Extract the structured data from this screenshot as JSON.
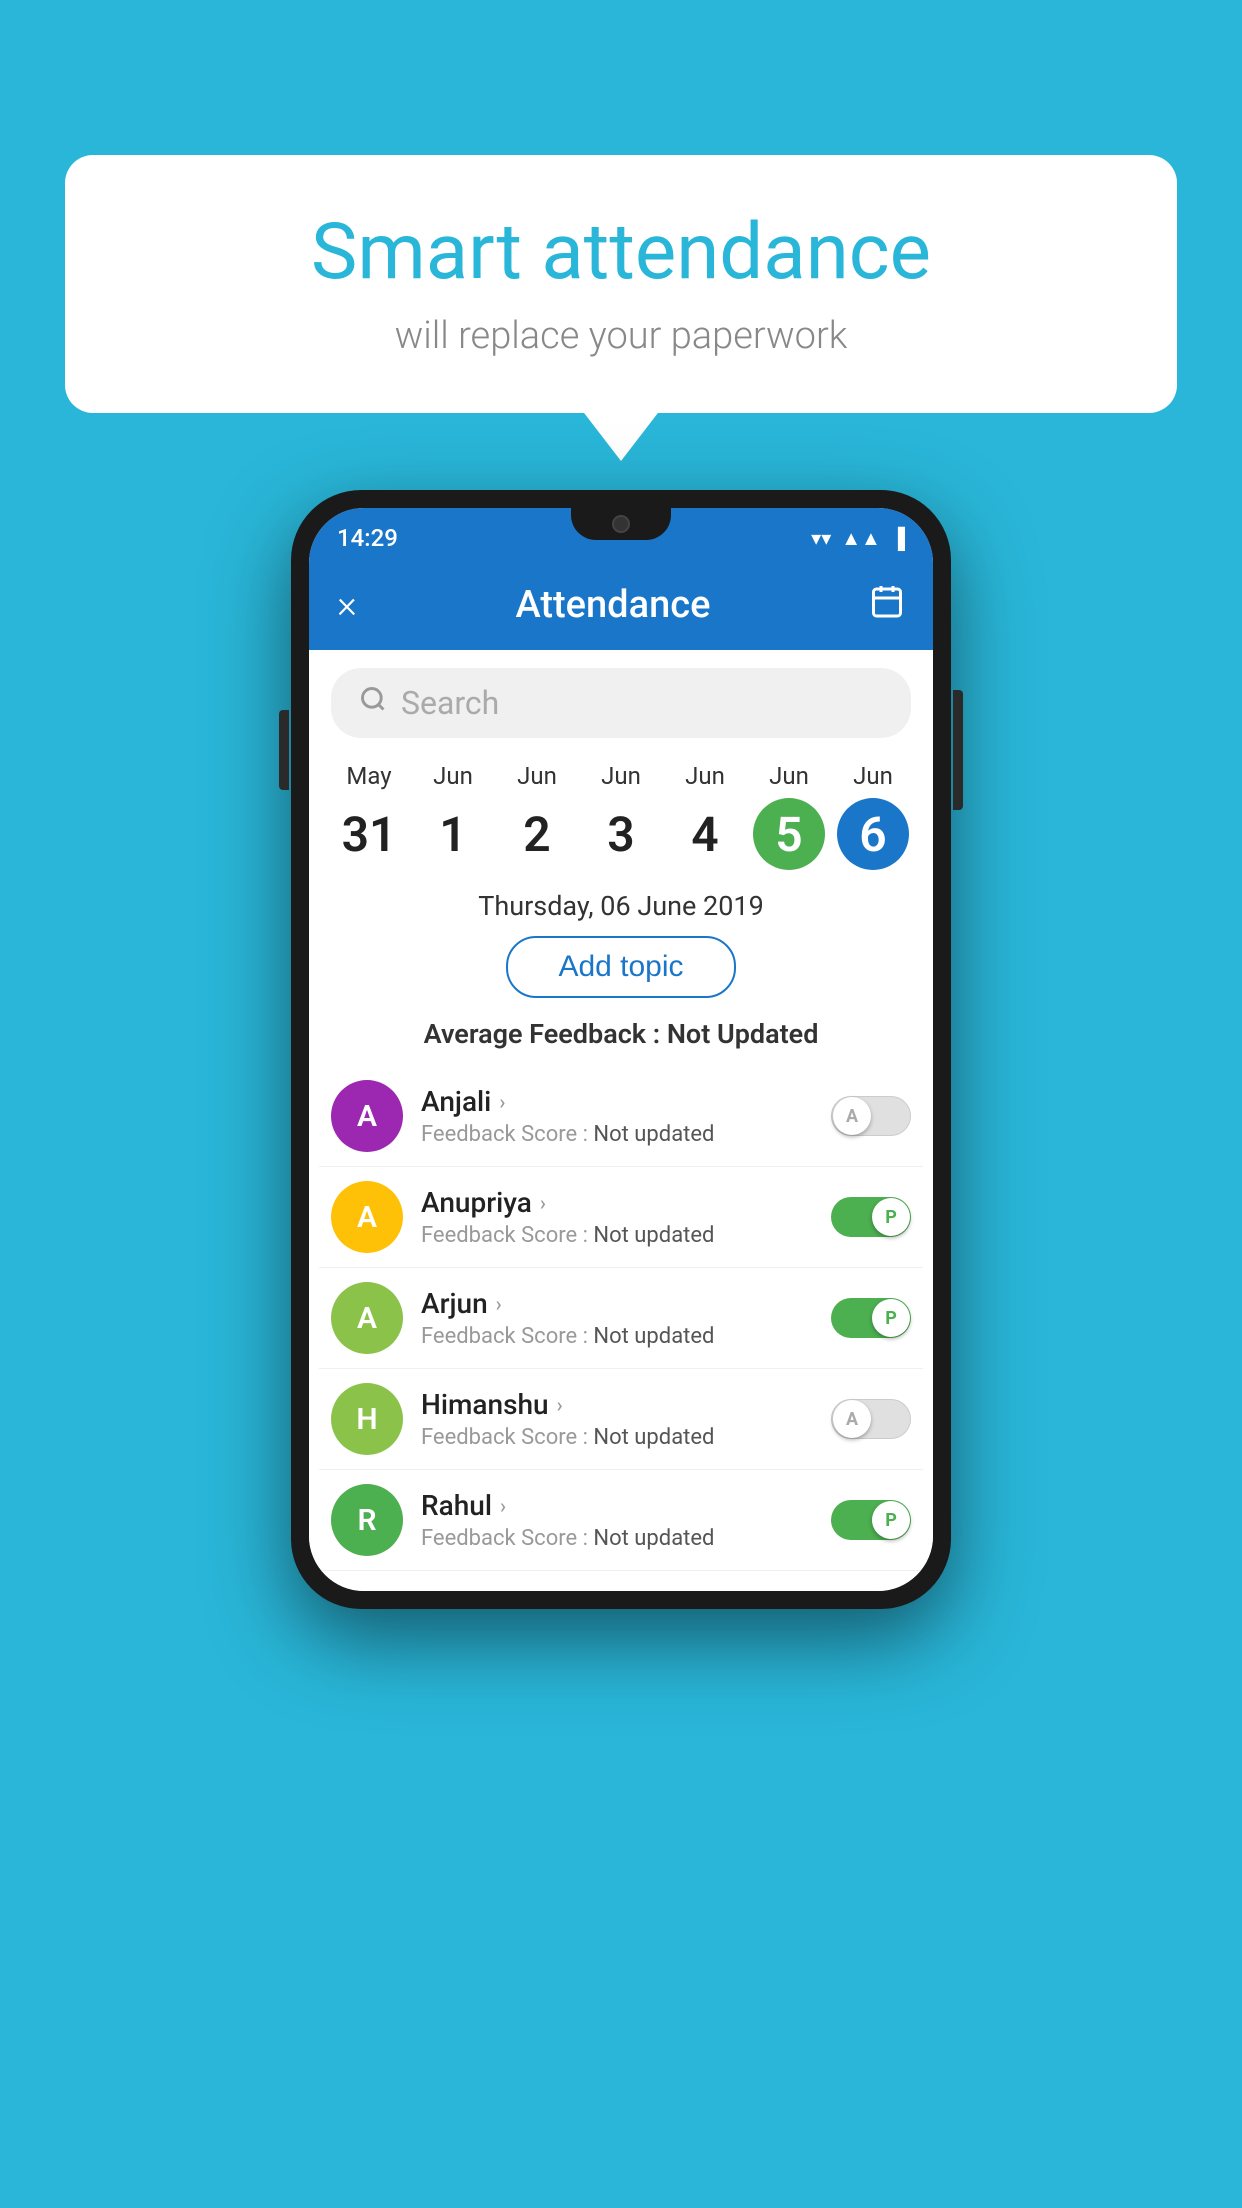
{
  "background_color": "#29b6d8",
  "speech_bubble": {
    "title": "Smart attendance",
    "subtitle": "will replace your paperwork"
  },
  "status_bar": {
    "time": "14:29",
    "icons": [
      "wifi",
      "signal",
      "battery"
    ]
  },
  "app_header": {
    "title": "Attendance",
    "close_label": "×",
    "calendar_icon": "📅"
  },
  "search": {
    "placeholder": "Search"
  },
  "dates": [
    {
      "month": "May",
      "day": "31",
      "state": "normal"
    },
    {
      "month": "Jun",
      "day": "1",
      "state": "normal"
    },
    {
      "month": "Jun",
      "day": "2",
      "state": "normal"
    },
    {
      "month": "Jun",
      "day": "3",
      "state": "normal"
    },
    {
      "month": "Jun",
      "day": "4",
      "state": "normal"
    },
    {
      "month": "Jun",
      "day": "5",
      "state": "today"
    },
    {
      "month": "Jun",
      "day": "6",
      "state": "selected"
    }
  ],
  "selected_date_label": "Thursday, 06 June 2019",
  "add_topic_label": "Add topic",
  "avg_feedback": {
    "label": "Average Feedback : ",
    "value": "Not Updated"
  },
  "students": [
    {
      "name": "Anjali",
      "avatar_letter": "A",
      "avatar_color": "#9c27b0",
      "feedback_label": "Feedback Score : ",
      "feedback_value": "Not updated",
      "toggle": "off",
      "toggle_label": "A"
    },
    {
      "name": "Anupriya",
      "avatar_letter": "A",
      "avatar_color": "#ffc107",
      "feedback_label": "Feedback Score : ",
      "feedback_value": "Not updated",
      "toggle": "on",
      "toggle_label": "P"
    },
    {
      "name": "Arjun",
      "avatar_letter": "A",
      "avatar_color": "#8bc34a",
      "feedback_label": "Feedback Score : ",
      "feedback_value": "Not updated",
      "toggle": "on",
      "toggle_label": "P"
    },
    {
      "name": "Himanshu",
      "avatar_letter": "H",
      "avatar_color": "#8bc34a",
      "feedback_label": "Feedback Score : ",
      "feedback_value": "Not updated",
      "toggle": "off",
      "toggle_label": "A"
    },
    {
      "name": "Rahul",
      "avatar_letter": "R",
      "avatar_color": "#4caf50",
      "feedback_label": "Feedback Score : ",
      "feedback_value": "Not updated",
      "toggle": "on",
      "toggle_label": "P"
    }
  ]
}
